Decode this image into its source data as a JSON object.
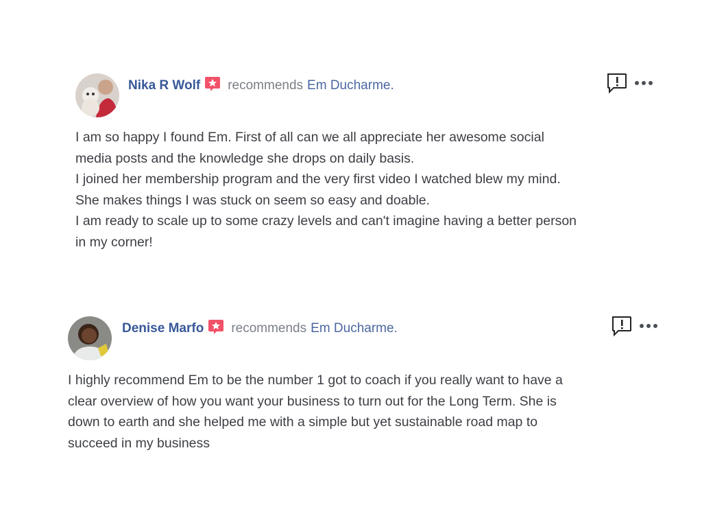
{
  "reviews": [
    {
      "author": "Nika R Wolf",
      "verb": "recommends",
      "target": "Em Ducharme.",
      "lines": [
        "I am so happy I found Em. First of all can we all appreciate her awesome social",
        "media posts and the knowledge she drops on daily basis.",
        "I joined her membership program and the very first video I watched blew my mind.",
        "She makes things I was stuck on seem so easy and doable.",
        "I am ready to scale up to some crazy levels and can't imagine having a better person",
        "in my corner!"
      ]
    },
    {
      "author": "Denise Marfo",
      "verb": "recommends",
      "target": "Em Ducharme.",
      "lines": [
        "I highly recommend Em to be the number 1 got to coach if you really want to have a",
        "clear overview of how you want your business to turn out for the Long Term. She is",
        "down to earth and she helped me with a simple but yet sustainable road map to",
        "succeed in my business"
      ]
    }
  ],
  "icons": {
    "badge": "recommendation-star-badge-icon",
    "report": "report-flag-icon",
    "more": "more-options-icon"
  },
  "colors": {
    "author": "#385898",
    "link": "#4b67a1",
    "muted": "#7a7f87",
    "text": "#3c3e44",
    "badge": "#f25268"
  }
}
